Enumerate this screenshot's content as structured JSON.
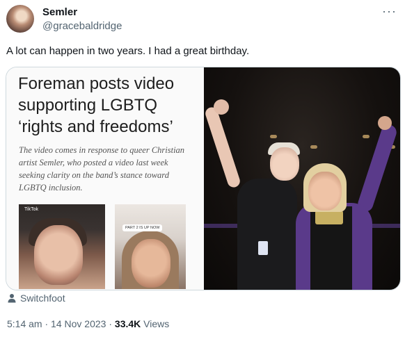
{
  "author": {
    "name": "Semler",
    "handle": "@gracebaldridge"
  },
  "tweet": {
    "text": "A lot can happen in two years. I had a great birthday."
  },
  "media": {
    "article": {
      "headline": "Foreman posts video supporting LGBTQ ‘rights and freedoms’",
      "subtext": "The video comes in response to queer Christian artist Semler, who posted a video last week seeking clarity on the band’s stance toward LGBTQ inclusion.",
      "thumb_left_label": "TikTok",
      "thumb_right_caption": "PART 2 IS UP NOW"
    }
  },
  "tagged": {
    "name": "Switchfoot"
  },
  "meta": {
    "time": "5:14 am",
    "sep1": " · ",
    "date": "14 Nov 2023",
    "sep2": " · ",
    "views_count": "33.4K",
    "views_label": " Views"
  },
  "icons": {
    "more": "more-icon",
    "person": "person-icon"
  }
}
